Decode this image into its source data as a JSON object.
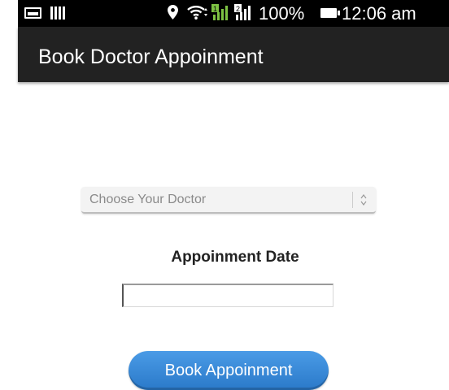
{
  "status_bar": {
    "battery_percent": "100%",
    "time": "12:06 am",
    "icons": [
      "image-icon",
      "barcode-icon",
      "location-icon",
      "wifi-icon",
      "signal-icon",
      "signal-icon",
      "battery-icon"
    ]
  },
  "action_bar": {
    "title": "Book Doctor Appoinment",
    "background": "#222222"
  },
  "form": {
    "doctor_spinner": {
      "selected": "Choose Your Doctor"
    },
    "date_label": "Appoinment Date",
    "date_input": {
      "value": "",
      "placeholder": ""
    },
    "book_button_label": "Book Appoinment",
    "button_color": "#3b8ad8"
  }
}
